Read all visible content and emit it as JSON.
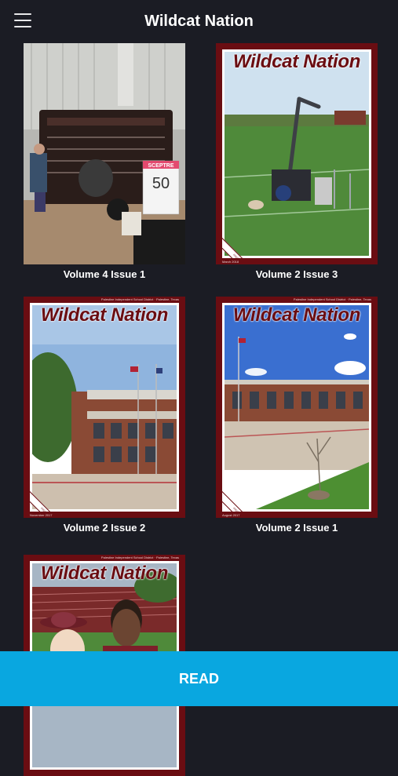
{
  "header": {
    "title": "Wildcat Nation",
    "menu_icon": "hamburger-menu-icon"
  },
  "issues": [
    {
      "label": "Volume 4 Issue 1",
      "cover": {
        "sign_brand": "SCEPTRE",
        "sign_number": "50"
      }
    },
    {
      "label": "Volume 2 Issue 3",
      "cover": {
        "masthead": "Wildcat Nation",
        "date": "March 2018",
        "corner_text": "PISD wildcatnation"
      }
    },
    {
      "label": "Volume 2 Issue 2",
      "cover": {
        "masthead": "Wildcat Nation",
        "topline": "Palestine Independent School District · Palestine, Texas",
        "date": "November 2017",
        "corner_text": "PISD wildcatnation"
      }
    },
    {
      "label": "Volume 2 Issue 1",
      "cover": {
        "masthead": "Wildcat Nation",
        "topline": "Palestine Independent School District · Palestine, Texas",
        "date": "August 2017",
        "corner_text": "PISD wildcatnation"
      }
    },
    {
      "label": "",
      "cover": {
        "masthead": "Wildcat Nation",
        "topline": "Palestine Independent School District · Palestine, Texas"
      }
    }
  ],
  "footer": {
    "read_label": "READ"
  },
  "colors": {
    "background": "#1b1c24",
    "accent": "#09a7e0",
    "maroon": "#6a0d12"
  }
}
